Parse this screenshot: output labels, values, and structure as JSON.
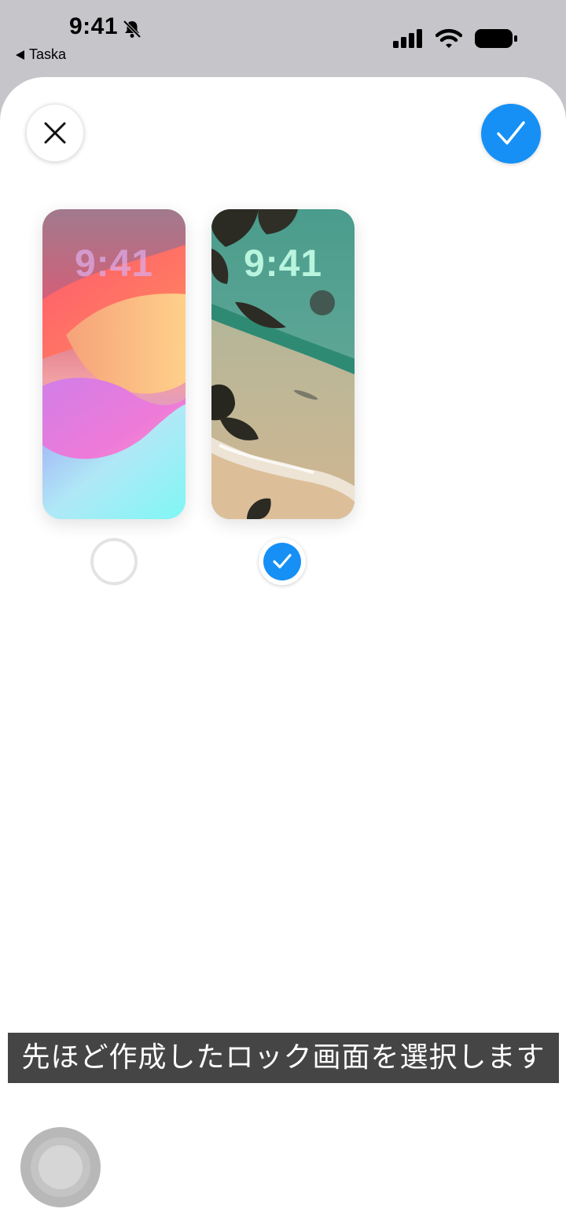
{
  "status_bar": {
    "time": "9:41",
    "back_label": "Taska",
    "icons": [
      "bell-slash-icon",
      "cellular-signal-icon",
      "wifi-icon",
      "battery-icon"
    ]
  },
  "toolbar": {
    "close_icon": "close-icon",
    "done_icon": "checkmark-icon"
  },
  "wallpapers": [
    {
      "time": "9:41",
      "style": "colorful-gradient",
      "selected": false
    },
    {
      "time": "9:41",
      "style": "beach-aerial",
      "selected": true
    }
  ],
  "caption": "先ほど作成したロック画面を選択します",
  "colors": {
    "accent": "#1690f5",
    "caption_bg": "#454545"
  }
}
